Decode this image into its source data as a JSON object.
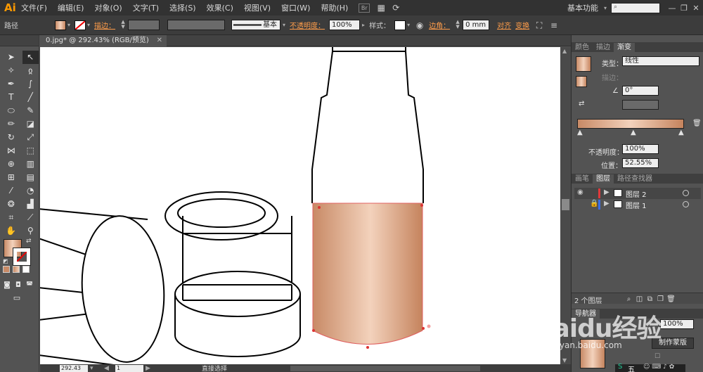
{
  "app": {
    "logo": "Ai",
    "menus": [
      "文件(F)",
      "编辑(E)",
      "对象(O)",
      "文字(T)",
      "选择(S)",
      "效果(C)",
      "视图(V)",
      "窗口(W)",
      "帮助(H)"
    ],
    "bridge_button": "Br",
    "workspace": "基本功能",
    "window_controls": [
      "—",
      "❐",
      "✕"
    ]
  },
  "control_bar": {
    "object_label": "路径",
    "stroke_label": "描边：",
    "brush_label": "基本",
    "opacity_label": "不透明度：",
    "opacity_value": "100%",
    "style_label": "样式：",
    "corner_label": "边角：",
    "corner_value": "0 mm",
    "align_label": "对齐",
    "transform_label": "变换"
  },
  "document": {
    "tab_title": "0.jpg* @ 292.43% (RGB/预览)",
    "close_icon": "✕"
  },
  "status_bar": {
    "zoom": "292.43",
    "artboard": "1",
    "tool_name": "直接选择"
  },
  "gradient_panel": {
    "tabs": [
      "颜色",
      "描边",
      "渐变"
    ],
    "type_label": "类型：",
    "type_value": "线性",
    "stroke_label": "描边：",
    "angle_value": "0°",
    "opacity_label": "不透明度：",
    "opacity_value": "100%",
    "location_label": "位置：",
    "location_value": "52.55%",
    "colors": {
      "left": "#c88a66",
      "mid": "#f3d2bc",
      "right": "#c5835d"
    }
  },
  "layers_panel": {
    "tabs": [
      "画笔",
      "图层",
      "路径查找器"
    ],
    "layers": [
      {
        "name": "图层 2",
        "color": "#e0393b"
      },
      {
        "name": "图层 1",
        "color": "#3a6ee8"
      }
    ],
    "count_label": "2 个图层"
  },
  "navigator_panel": {
    "tab": "导航器",
    "zoom_value": "100%",
    "make_mask_button": "制作蒙版"
  },
  "watermark": {
    "brand": "Baidu经验",
    "url": "jingyan.baidu.com"
  },
  "taskbar": {
    "ime": "五"
  }
}
